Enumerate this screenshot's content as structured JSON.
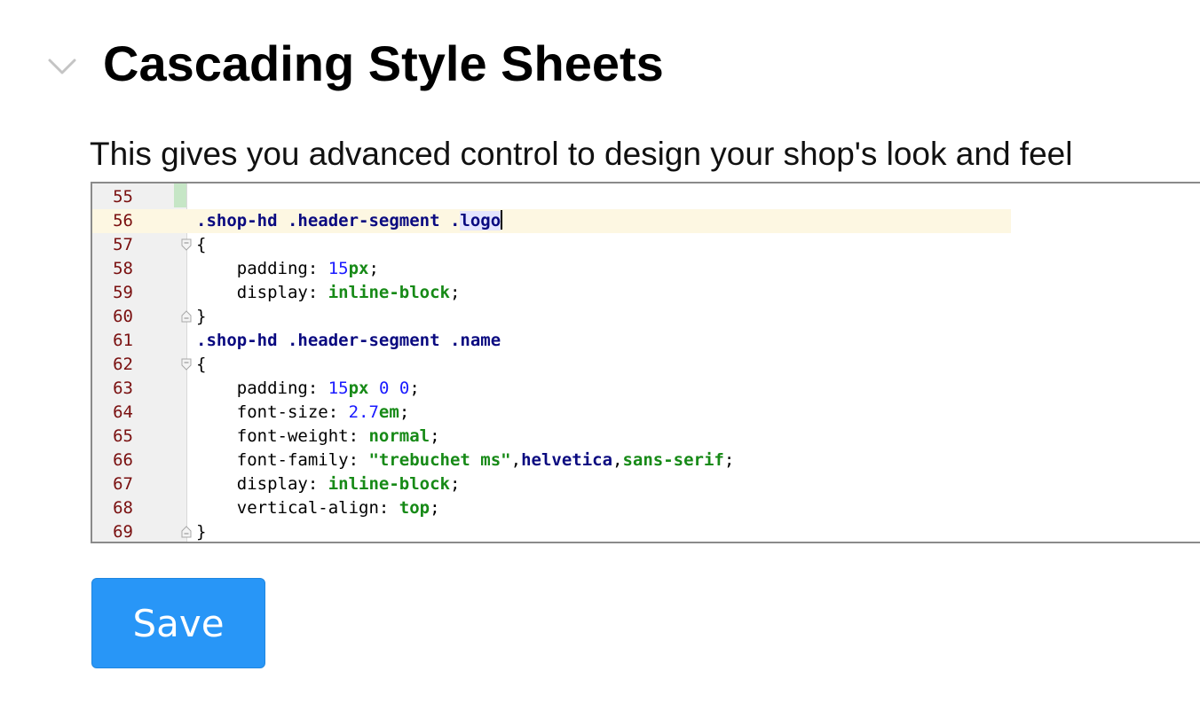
{
  "section": {
    "title": "Cascading Style Sheets",
    "description": "This gives you advanced control to design your shop's look and feel",
    "collapse_icon": "chevron-down-icon"
  },
  "editor": {
    "lines": [
      {
        "number": "55",
        "tokens": []
      },
      {
        "number": "56",
        "current": true,
        "tokens": [
          {
            "t": ".shop-hd .header-segment .",
            "c": "sel"
          },
          {
            "t": "logo",
            "c": "sel-hl"
          },
          {
            "t": "",
            "c": "caret"
          }
        ]
      },
      {
        "number": "57",
        "fold": "open",
        "tokens": [
          {
            "t": "{",
            "c": "plain"
          }
        ]
      },
      {
        "number": "58",
        "tokens": [
          {
            "t": "    padding: ",
            "c": "prop"
          },
          {
            "t": "15",
            "c": "num"
          },
          {
            "t": "px",
            "c": "unit"
          },
          {
            "t": ";",
            "c": "plain"
          }
        ]
      },
      {
        "number": "59",
        "tokens": [
          {
            "t": "    display: ",
            "c": "prop"
          },
          {
            "t": "inline-block",
            "c": "kw"
          },
          {
            "t": ";",
            "c": "plain"
          }
        ]
      },
      {
        "number": "60",
        "fold": "close",
        "tokens": [
          {
            "t": "}",
            "c": "plain"
          }
        ]
      },
      {
        "number": "61",
        "tokens": [
          {
            "t": ".shop-hd .header-segment .name",
            "c": "sel"
          }
        ]
      },
      {
        "number": "62",
        "fold": "open",
        "tokens": [
          {
            "t": "{",
            "c": "plain"
          }
        ]
      },
      {
        "number": "63",
        "tokens": [
          {
            "t": "    padding: ",
            "c": "prop"
          },
          {
            "t": "15",
            "c": "num"
          },
          {
            "t": "px",
            "c": "unit"
          },
          {
            "t": " ",
            "c": "plain"
          },
          {
            "t": "0",
            "c": "num"
          },
          {
            "t": " ",
            "c": "plain"
          },
          {
            "t": "0",
            "c": "num"
          },
          {
            "t": ";",
            "c": "plain"
          }
        ]
      },
      {
        "number": "64",
        "tokens": [
          {
            "t": "    font-size: ",
            "c": "prop"
          },
          {
            "t": "2.7",
            "c": "num"
          },
          {
            "t": "em",
            "c": "unit"
          },
          {
            "t": ";",
            "c": "plain"
          }
        ]
      },
      {
        "number": "65",
        "tokens": [
          {
            "t": "    font-weight: ",
            "c": "prop"
          },
          {
            "t": "normal",
            "c": "kw"
          },
          {
            "t": ";",
            "c": "plain"
          }
        ]
      },
      {
        "number": "66",
        "tokens": [
          {
            "t": "    font-family: ",
            "c": "prop"
          },
          {
            "t": "\"trebuchet ms\"",
            "c": "str"
          },
          {
            "t": ",",
            "c": "plain"
          },
          {
            "t": "helvetica",
            "c": "sel"
          },
          {
            "t": ",",
            "c": "plain"
          },
          {
            "t": "sans-serif",
            "c": "kw"
          },
          {
            "t": ";",
            "c": "plain"
          }
        ]
      },
      {
        "number": "67",
        "tokens": [
          {
            "t": "    display: ",
            "c": "prop"
          },
          {
            "t": "inline-block",
            "c": "kw"
          },
          {
            "t": ";",
            "c": "plain"
          }
        ]
      },
      {
        "number": "68",
        "tokens": [
          {
            "t": "    vertical-align: ",
            "c": "prop"
          },
          {
            "t": "top",
            "c": "kw"
          },
          {
            "t": ";",
            "c": "plain"
          }
        ]
      },
      {
        "number": "69",
        "fold": "close",
        "tokens": [
          {
            "t": "}",
            "c": "plain"
          }
        ]
      }
    ]
  },
  "actions": {
    "save_label": "Save"
  },
  "colors": {
    "save_button": "#2896f7",
    "line_number": "#7a1010",
    "selector": "#0a0a80",
    "keyword": "#178a17",
    "number": "#1a1aff",
    "current_line": "#fdf7e2"
  }
}
